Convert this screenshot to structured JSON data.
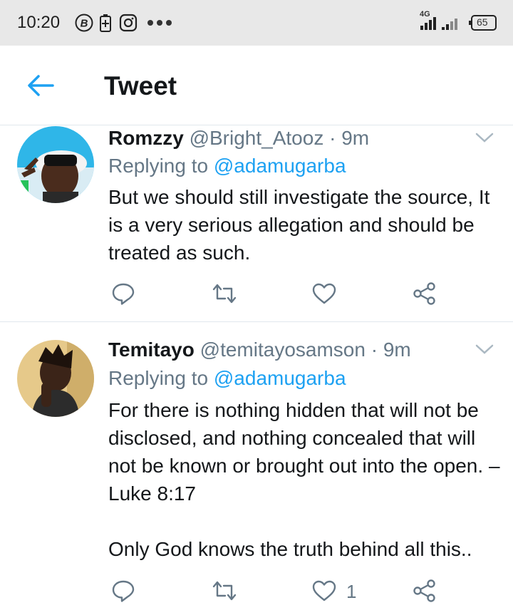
{
  "status_bar": {
    "time": "10:20",
    "network": "4G",
    "battery": "65",
    "icons": [
      "b-icon",
      "battery-saver-icon",
      "instagram-icon",
      "more-dots-icon",
      "signal-icon",
      "battery-icon"
    ]
  },
  "header": {
    "title": "Tweet",
    "back_icon": "arrow-left-icon",
    "accent_color": "#1da1f2"
  },
  "tweets": [
    {
      "display_name": "Romzzy",
      "handle": "@Bright_Atooz",
      "separator": "·",
      "time": "9m",
      "replying_label": "Replying to",
      "replying_to": "@adamugarba",
      "text": "But we should still investigate the source, It is a very serious allegation and should be treated as such.",
      "like_count": ""
    },
    {
      "display_name": "Temitayo",
      "handle": "@temitayosamson",
      "separator": "·",
      "time": "9m",
      "replying_label": "Replying to",
      "replying_to": "@adamugarba",
      "text_line1": "For there is nothing hidden that will not be disclosed, and nothing concealed that will not be known or brought out into the open. – Luke 8:17",
      "text_line2": "Only God knows the truth behind all this..",
      "like_count": "1"
    }
  ]
}
